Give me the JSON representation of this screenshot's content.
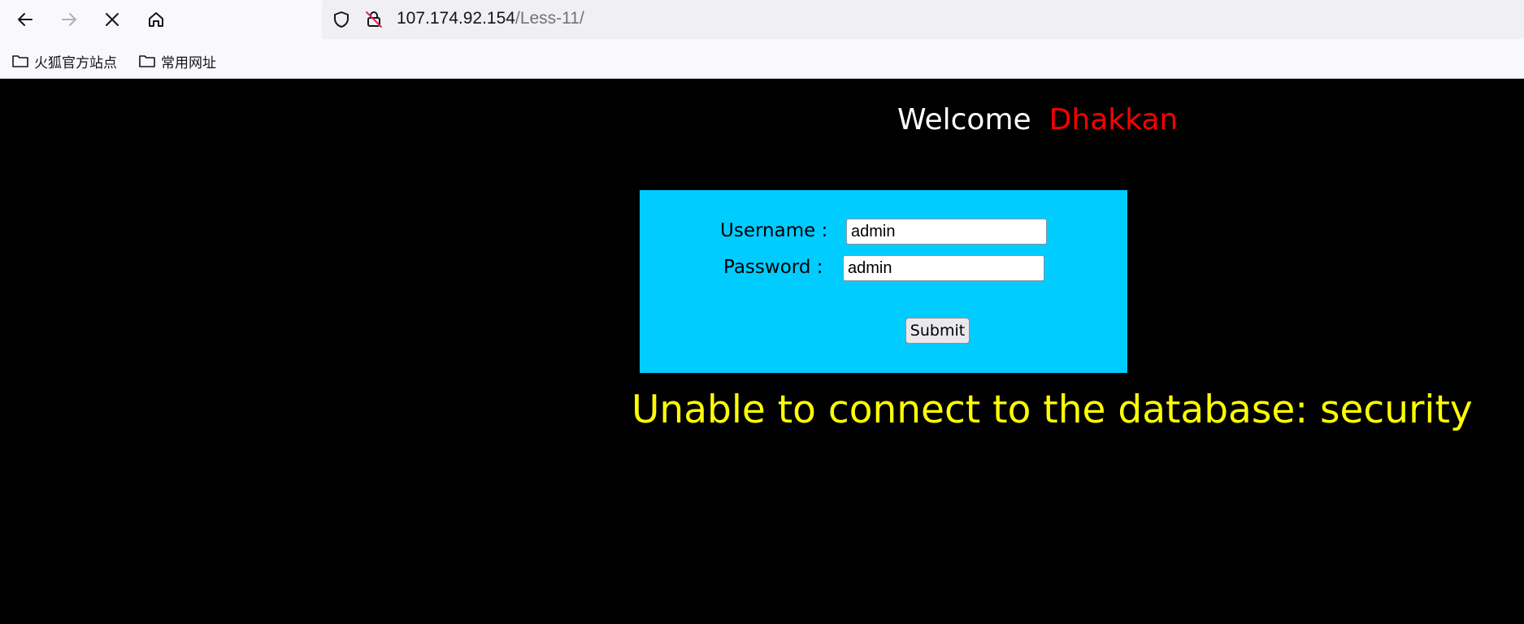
{
  "browser": {
    "url_host": "107.174.92.154",
    "url_path": "/Less-11/",
    "bookmarks": [
      {
        "label": "火狐官方站点"
      },
      {
        "label": "常用网址"
      }
    ]
  },
  "page": {
    "welcome": "Welcome",
    "name": "Dhakkan",
    "form": {
      "username_label": "Username :",
      "username_value": "admin",
      "password_label": "Password :",
      "password_value": "admin",
      "submit_label": "Submit"
    },
    "error_message": "Unable to connect to the database: security"
  },
  "colors": {
    "welcome_text": "#ffffff",
    "name_text": "#ff0000",
    "form_bg": "#00ccff",
    "error_text": "#ffff00",
    "page_bg": "#000000"
  }
}
